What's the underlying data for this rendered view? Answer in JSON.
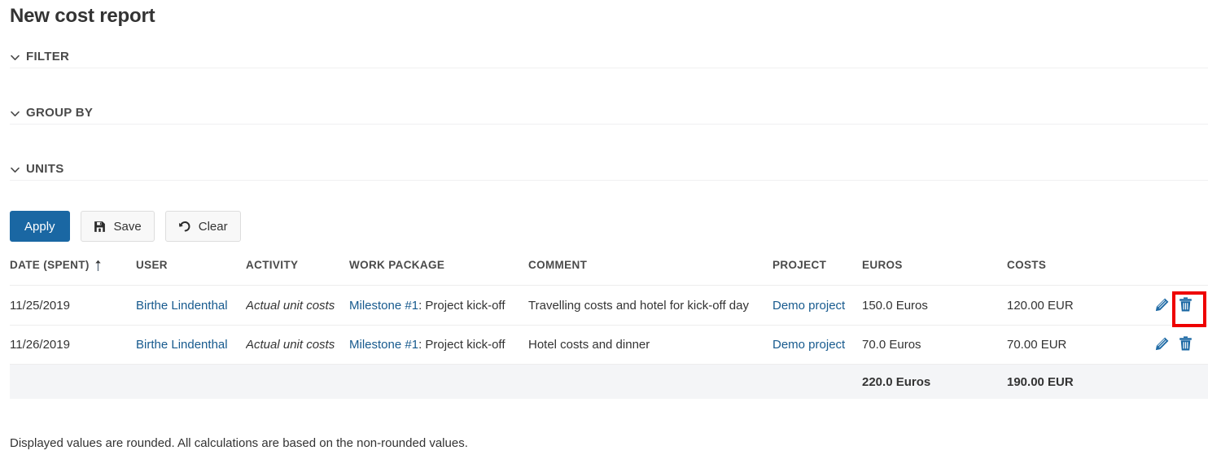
{
  "page": {
    "title": "New cost report",
    "footnote": "Displayed values are rounded. All calculations are based on the non-rounded values."
  },
  "colors": {
    "accent": "#1a67a3",
    "link": "#175a8e",
    "highlight": "#ee0000",
    "total_row_bg": "#f4f5f7",
    "rule": "#f0f0f1"
  },
  "sections": [
    {
      "label": "FILTER",
      "icon": "chevron-down-icon",
      "expanded": false
    },
    {
      "label": "GROUP BY",
      "icon": "chevron-down-icon",
      "expanded": false
    },
    {
      "label": "UNITS",
      "icon": "chevron-down-icon",
      "expanded": false
    }
  ],
  "buttons": {
    "apply": {
      "label": "Apply",
      "icon": null
    },
    "save": {
      "label": "Save",
      "icon": "floppy-disk-icon"
    },
    "clear": {
      "label": "Clear",
      "icon": "undo-arrow-icon"
    }
  },
  "table": {
    "columns": [
      {
        "key": "date",
        "label": "DATE (SPENT)",
        "sorted": true,
        "sort_icon": "sort-ascending-arrow-icon"
      },
      {
        "key": "user",
        "label": "USER"
      },
      {
        "key": "activity",
        "label": "ACTIVITY"
      },
      {
        "key": "work_package",
        "label": "WORK PACKAGE"
      },
      {
        "key": "comment",
        "label": "COMMENT"
      },
      {
        "key": "project",
        "label": "PROJECT"
      },
      {
        "key": "euros",
        "label": "EUROS"
      },
      {
        "key": "costs",
        "label": "COSTS"
      },
      {
        "key": "actions",
        "label": ""
      }
    ],
    "rows": [
      {
        "date": "11/25/2019",
        "user": "Birthe Lindenthal",
        "activity": "Actual unit costs",
        "work_package_id": "Milestone #1",
        "work_package_sep": ": ",
        "work_package_name": "Project kick-off",
        "comment": "Travelling costs and hotel for kick-off day",
        "project": "Demo project",
        "euros": "150.0 Euros",
        "costs": "120.00 EUR",
        "actions": [
          {
            "name": "edit-icon",
            "title": "Edit"
          },
          {
            "name": "delete-icon",
            "title": "Delete",
            "highlighted": true
          }
        ]
      },
      {
        "date": "11/26/2019",
        "user": "Birthe Lindenthal",
        "activity": "Actual unit costs",
        "work_package_id": "Milestone #1",
        "work_package_sep": ": ",
        "work_package_name": "Project kick-off",
        "comment": "Hotel costs and dinner",
        "project": "Demo project",
        "euros": "70.0 Euros",
        "costs": "70.00 EUR",
        "actions": [
          {
            "name": "edit-icon",
            "title": "Edit"
          },
          {
            "name": "delete-icon",
            "title": "Delete",
            "highlighted": false
          }
        ]
      }
    ],
    "total": {
      "euros": "220.0 Euros",
      "costs": "190.00 EUR"
    }
  }
}
